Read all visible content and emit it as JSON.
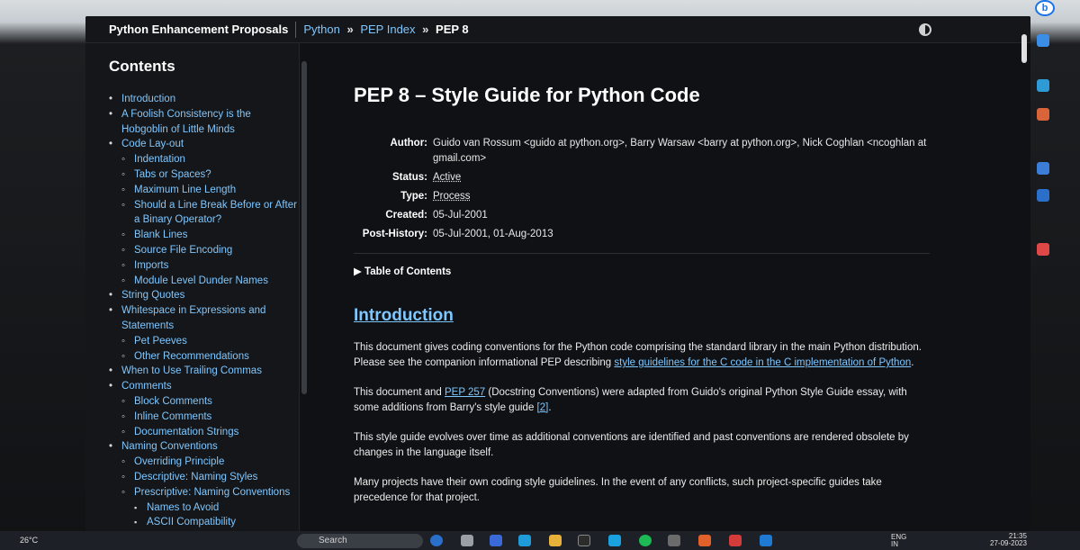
{
  "header": {
    "site_title": "Python Enhancement Proposals",
    "breadcrumb": [
      "Python",
      "PEP Index"
    ],
    "crumb_sep": "»",
    "current": "PEP 8"
  },
  "sidebar": {
    "heading": "Contents",
    "items": [
      {
        "level": 1,
        "label": "Introduction"
      },
      {
        "level": 1,
        "label": "A Foolish Consistency is the Hobgoblin of Little Minds"
      },
      {
        "level": 1,
        "label": "Code Lay-out"
      },
      {
        "level": 2,
        "label": "Indentation"
      },
      {
        "level": 2,
        "label": "Tabs or Spaces?"
      },
      {
        "level": 2,
        "label": "Maximum Line Length"
      },
      {
        "level": 2,
        "label": "Should a Line Break Before or After a Binary Operator?"
      },
      {
        "level": 2,
        "label": "Blank Lines"
      },
      {
        "level": 2,
        "label": "Source File Encoding"
      },
      {
        "level": 2,
        "label": "Imports"
      },
      {
        "level": 2,
        "label": "Module Level Dunder Names"
      },
      {
        "level": 1,
        "label": "String Quotes"
      },
      {
        "level": 1,
        "label": "Whitespace in Expressions and Statements"
      },
      {
        "level": 2,
        "label": "Pet Peeves"
      },
      {
        "level": 2,
        "label": "Other Recommendations"
      },
      {
        "level": 1,
        "label": "When to Use Trailing Commas"
      },
      {
        "level": 1,
        "label": "Comments"
      },
      {
        "level": 2,
        "label": "Block Comments"
      },
      {
        "level": 2,
        "label": "Inline Comments"
      },
      {
        "level": 2,
        "label": "Documentation Strings"
      },
      {
        "level": 1,
        "label": "Naming Conventions"
      },
      {
        "level": 2,
        "label": "Overriding Principle"
      },
      {
        "level": 2,
        "label": "Descriptive: Naming Styles"
      },
      {
        "level": 2,
        "label": "Prescriptive: Naming Conventions"
      },
      {
        "level": 3,
        "label": "Names to Avoid"
      },
      {
        "level": 3,
        "label": "ASCII Compatibility"
      }
    ]
  },
  "main": {
    "title": "PEP 8 – Style Guide for Python Code",
    "meta": {
      "author_label": "Author:",
      "author": "Guido van Rossum <guido at python.org>, Barry Warsaw <barry at python.org>, Nick Coghlan <ncoghlan at gmail.com>",
      "status_label": "Status:",
      "status": "Active",
      "type_label": "Type:",
      "type": "Process",
      "created_label": "Created:",
      "created": "05-Jul-2001",
      "history_label": "Post-History:",
      "history": "05-Jul-2001, 01-Aug-2013"
    },
    "toc_toggle": "▶ Table of Contents",
    "intro_heading": "Introduction",
    "p1_text": "This document gives coding conventions for the Python code comprising the standard library in the main Python distribution. Please see the companion informational PEP describing ",
    "p1_link": "style guidelines for the C code in the C implementation of Python",
    "p1_end": ".",
    "p2_start": "This document and ",
    "p2_link": "PEP 257",
    "p2_mid": " (Docstring Conventions) were adapted from Guido's original Python Style Guide essay, with some additions from Barry's style guide ",
    "p2_ref": "[2]",
    "p2_end": ".",
    "p3": "This style guide evolves over time as additional conventions are identified and past conventions are rendered obsolete by changes in the language itself.",
    "p4": "Many projects have their own coding style guidelines. In the event of any conflicts, such project-specific guides take precedence for that project."
  },
  "taskbar": {
    "temperature": "26°C",
    "search_placeholder": "Search",
    "lang": "ENG",
    "lang_sub": "IN",
    "time": "21:35",
    "date": "27-09-2023"
  },
  "colors": {
    "link": "#7fc7ff",
    "background": "#0f1114",
    "sidebar_bg": "#141619"
  }
}
